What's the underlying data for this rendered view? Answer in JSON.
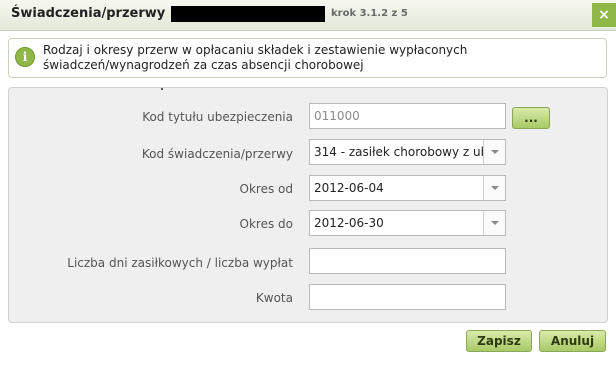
{
  "header": {
    "title": "Świadczenia/przerwy »",
    "step": "krok 3.1.2 z 5",
    "close_label": "×"
  },
  "info": {
    "line1": "Rodzaj i okresy przerw w opłacaniu składek i zestawienie wypłaconych",
    "line2": "świadczeń/wynagrodzeń za czas absencji chorobowej"
  },
  "form": {
    "kod_tytulu": {
      "label": "Kod tytułu ubezpieczenia",
      "value": "011000",
      "browse_label": "..."
    },
    "kod_swiadczenia": {
      "label": "Kod świadczenia/przerwy",
      "value": "314 - zasiłek chorobowy z ub"
    },
    "okres_od": {
      "label": "Okres od",
      "value": "2012-06-04"
    },
    "okres_do": {
      "label": "Okres do",
      "value": "2012-06-30"
    },
    "liczba_dni": {
      "label": "Liczba dni zasiłkowych / liczba wypłat",
      "value": ""
    },
    "kwota": {
      "label": "Kwota",
      "value": ""
    }
  },
  "buttons": {
    "save": "Zapisz",
    "cancel": "Anuluj"
  },
  "colors": {
    "accent": "#8fb848",
    "button_top": "#d9eaa9",
    "button_bottom": "#a8c966"
  }
}
